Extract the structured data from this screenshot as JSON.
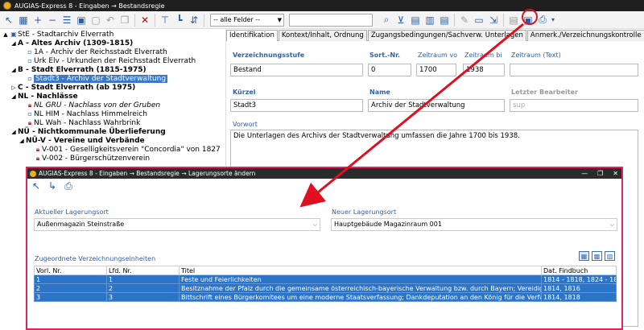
{
  "app": {
    "title": "AUGIAS-Express 8 - Eingaben → Bestandsregie"
  },
  "toolbar": {
    "field_filter": "-- alle Felder --",
    "search_value": ""
  },
  "tree": [
    {
      "label": "StE - Stadtarchiv Elverrath",
      "level": 0,
      "icon": "archive",
      "bold": false,
      "toggle": "▲"
    },
    {
      "label": "A - Altes Archiv (1309-1815)",
      "level": 1,
      "icon": "none",
      "bold": true,
      "toggle": "◢"
    },
    {
      "label": "1A - Archiv der Reichsstadt Elverrath",
      "level": 2,
      "icon": "doc",
      "bold": false,
      "toggle": ""
    },
    {
      "label": "Urk Elv - Urkunden der Reichsstadt Elverrath",
      "level": 2,
      "icon": "doc",
      "bold": false,
      "toggle": ""
    },
    {
      "label": "B - Stadt Elverrath (1815-1975)",
      "level": 1,
      "icon": "none",
      "bold": true,
      "toggle": "◢"
    },
    {
      "label": "Stadt3 - Archiv der Stadtverwaltung",
      "level": 2,
      "icon": "doc",
      "bold": false,
      "toggle": "",
      "selected": true
    },
    {
      "label": "C - Stadt Elverrath (ab 1975)",
      "level": 1,
      "icon": "none",
      "bold": true,
      "toggle": "▷"
    },
    {
      "label": "NL - Nachlässe",
      "level": 1,
      "icon": "none",
      "bold": true,
      "toggle": "◢"
    },
    {
      "label": "NL GRU - Nachlass von der Gruben",
      "level": 2,
      "icon": "lock",
      "bold": false,
      "toggle": "",
      "italic": true
    },
    {
      "label": "NL HIM - Nachlass Himmelreich",
      "level": 2,
      "icon": "doc",
      "bold": false,
      "toggle": ""
    },
    {
      "label": "NL Wah - Nachlass Wahrbrink",
      "level": 2,
      "icon": "lock",
      "bold": false,
      "toggle": ""
    },
    {
      "label": "NÜ - Nichtkommunale Überlieferung",
      "level": 1,
      "icon": "none",
      "bold": true,
      "toggle": "◢"
    },
    {
      "label": "NÜ-V - Vereine und Verbände",
      "level": 2,
      "icon": "none",
      "bold": true,
      "toggle": "◢"
    },
    {
      "label": "V-001 - Geselligkeitsverein \"Concordia\" von 1827",
      "level": 3,
      "icon": "lock",
      "bold": false,
      "toggle": ""
    },
    {
      "label": "V-002 - Bürgerschützenverein",
      "level": 3,
      "icon": "lock",
      "bold": false,
      "toggle": ""
    }
  ],
  "tabs": [
    {
      "label": "Identifikation",
      "active": true
    },
    {
      "label": "Kontext/Inhalt, Ordnung",
      "active": false
    },
    {
      "label": "Zugangsbedingungen/Sachverw. Unterlagen",
      "active": false
    },
    {
      "label": "Anmerk./Verzeichnungskontrolle",
      "active": false
    }
  ],
  "form": {
    "verzeichnungsstufe_label": "Verzeichnungsstufe",
    "verzeichnungsstufe_value": "Bestand",
    "sortnr_label": "Sort.-Nr.",
    "sortnr_value": "0",
    "zeitraum_von_label": "Zeitraum vo",
    "zeitraum_von_value": "1700",
    "zeitraum_bis_label": "Zeitraum bi",
    "zeitraum_bis_value": "1938",
    "zeitraum_text_label": "Zeitraum (Text)",
    "zeitraum_text_value": "",
    "kuerzel_label": "Kürzel",
    "kuerzel_value": "Stadt3",
    "name_label": "Name",
    "name_value": "Archiv der Stadtverwaltung",
    "bearbeiter_label": "Letzter Bearbeiter",
    "bearbeiter_value": "sup",
    "vorwort_label": "Vorwort",
    "vorwort_value": "Die Unterlagen des Archivs der Stadtverwaltung umfassen die Jahre 1700 bis 1938."
  },
  "dialog": {
    "title": "AUGIAS-Express 8 - Eingaben → Bestandsregie → Lagerungsorte ändern",
    "current_label": "Aktueller Lagerungsort",
    "current_value": "Außenmagazin Steinstraße",
    "new_label": "Neuer Lagerungsort",
    "new_value": "Hauptgebäude Magazinraum 001",
    "units_label": "Zugeordnete Verzeichnungseinheiten",
    "columns": [
      "Vorl. Nr.",
      "Lfd. Nr.",
      "Titel",
      "Dat. Findbuch"
    ],
    "rows": [
      [
        "1",
        "1",
        "Feste und Feierlichkeiten",
        "1814 - 1818, 1824 - 18"
      ],
      [
        "2",
        "2",
        "Besitznahme der Pfalz durch die gemeinsame österreichisch-bayerische Verwaltung bzw. durch Bayern; Vereidigung der Be",
        "1814, 1816"
      ],
      [
        "3",
        "3",
        "Bittschrift eines Bürgerkomitees um eine moderne Staatsverfassung; Dankdeputation an den König für die Verfassung.",
        "1814, 1818"
      ]
    ]
  },
  "colors": {
    "accent": "#2b74c8",
    "highlight": "#e01020",
    "dialog_border": "#e0245e"
  }
}
